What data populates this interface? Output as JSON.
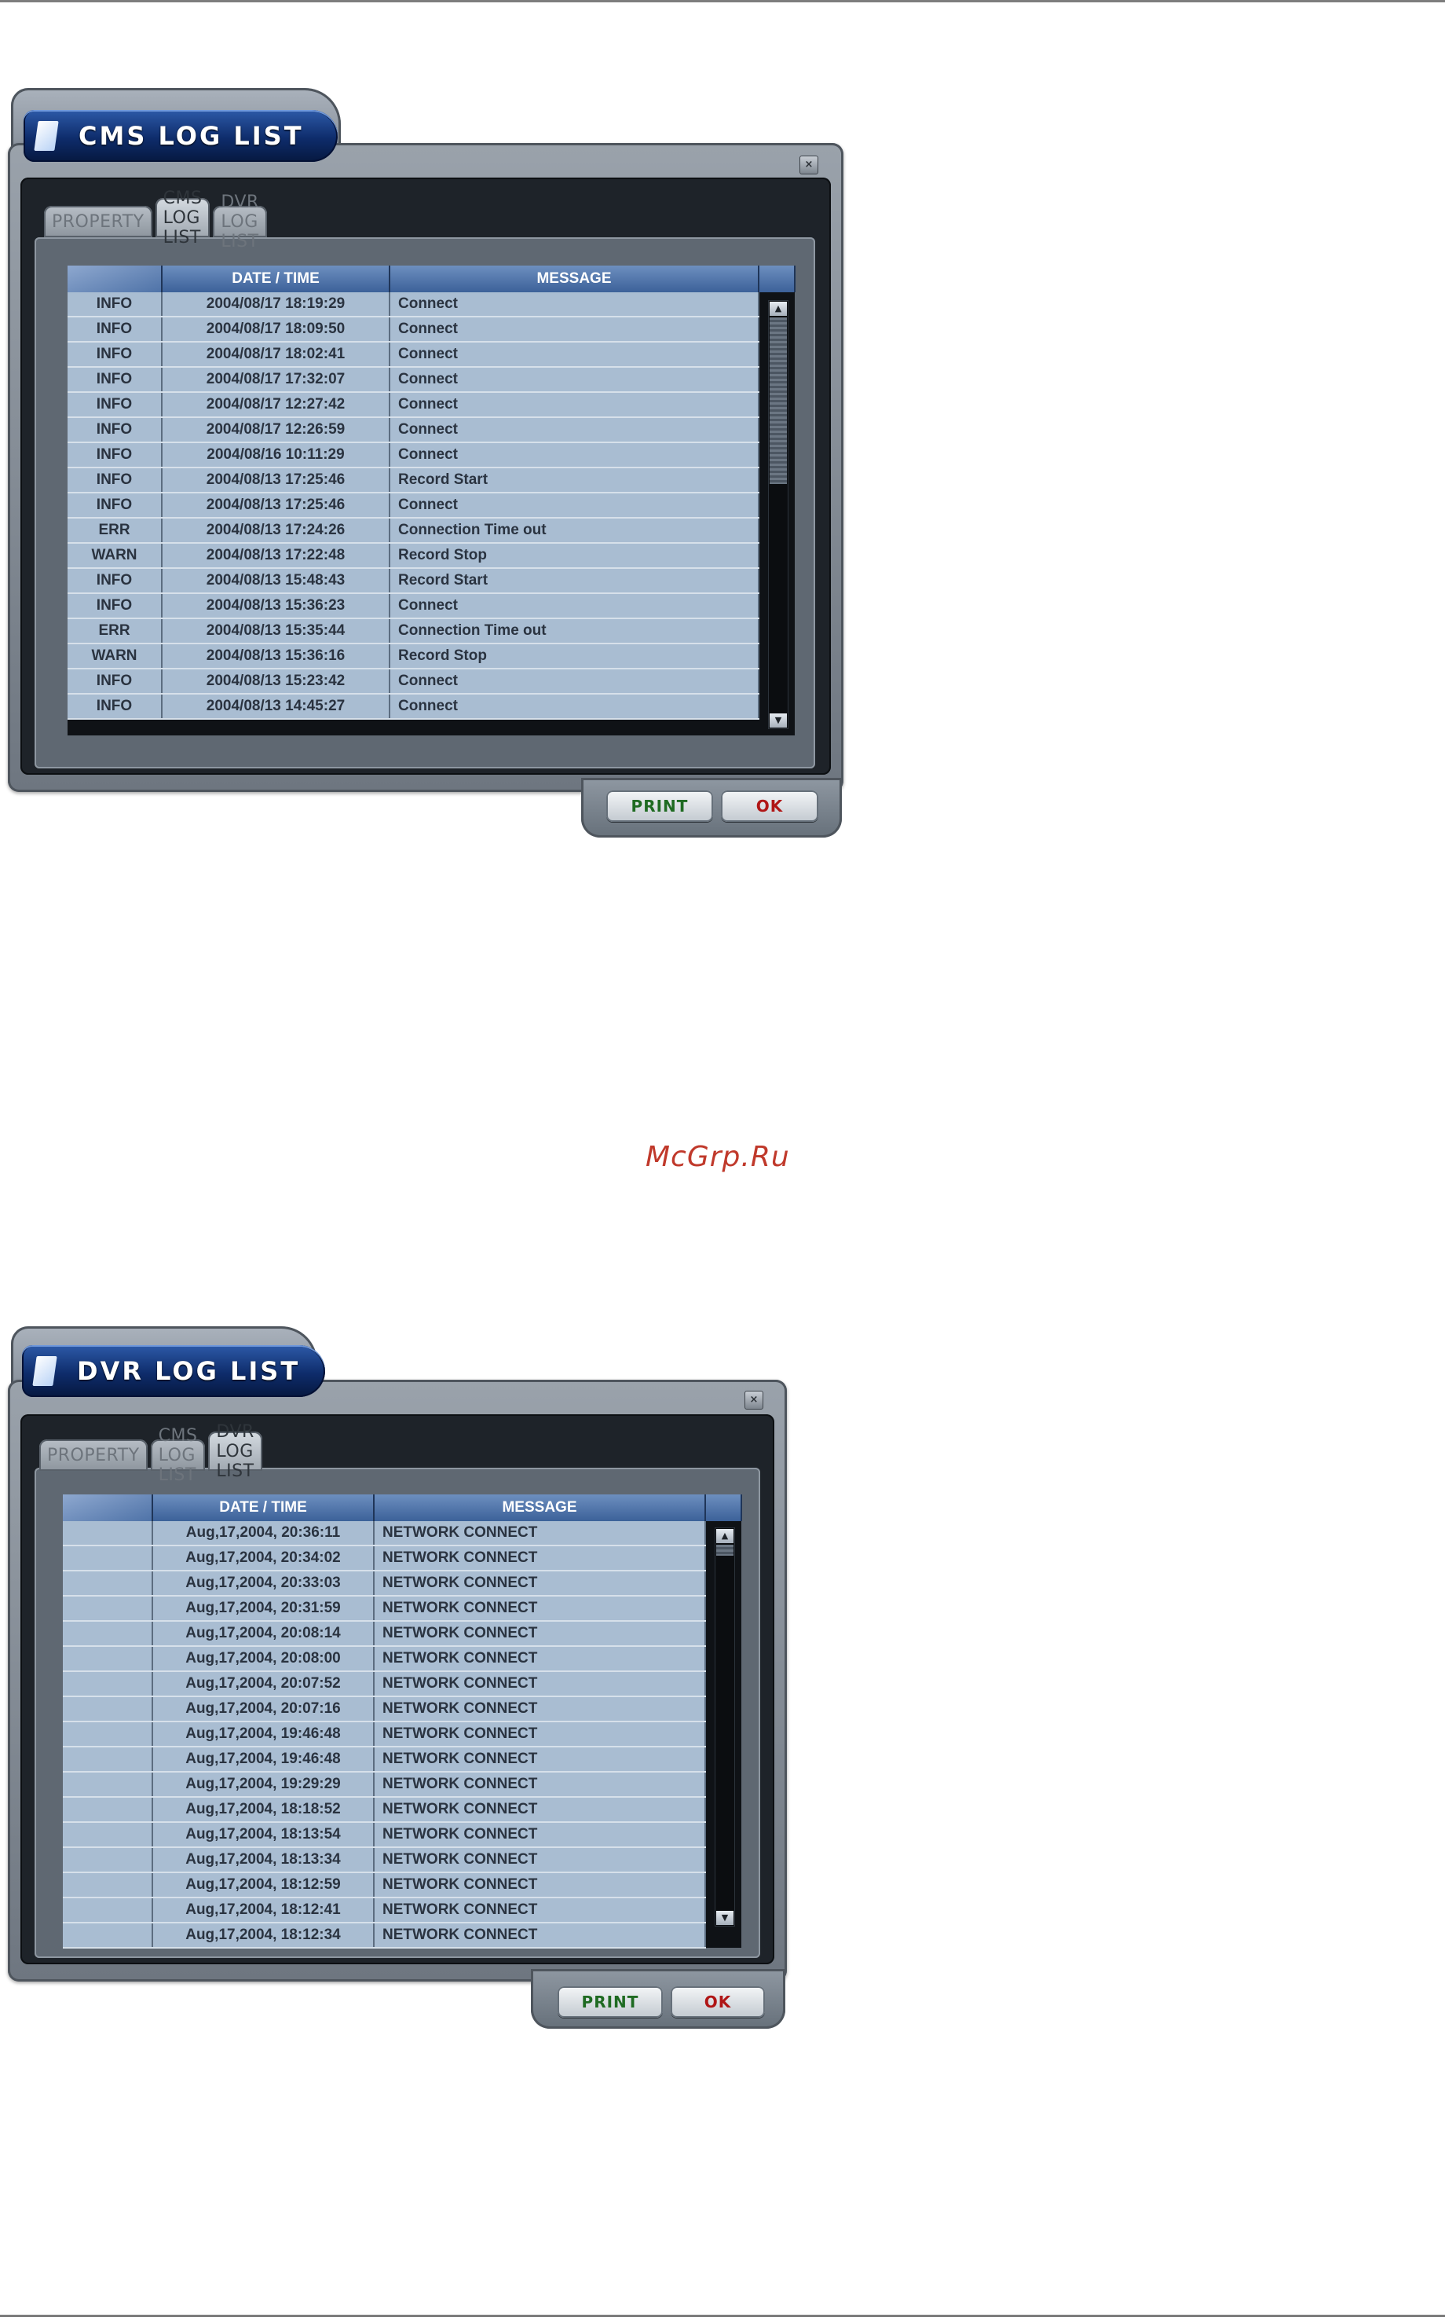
{
  "watermark": "McGrp.Ru",
  "windows": [
    {
      "title": "CMS LOG LIST",
      "close_glyph": "×",
      "tabs": [
        "PROPERTY",
        "CMS LOG LIST",
        "DVR LOG LIST"
      ],
      "active_tab": 1,
      "headers": [
        "",
        "DATE / TIME",
        "MESSAGE"
      ],
      "rows": [
        [
          "INFO",
          "2004/08/17 18:19:29",
          "Connect"
        ],
        [
          "INFO",
          "2004/08/17 18:09:50",
          "Connect"
        ],
        [
          "INFO",
          "2004/08/17 18:02:41",
          "Connect"
        ],
        [
          "INFO",
          "2004/08/17 17:32:07",
          "Connect"
        ],
        [
          "INFO",
          "2004/08/17 12:27:42",
          "Connect"
        ],
        [
          "INFO",
          "2004/08/17 12:26:59",
          "Connect"
        ],
        [
          "INFO",
          "2004/08/16 10:11:29",
          "Connect"
        ],
        [
          "INFO",
          "2004/08/13 17:25:46",
          "Record Start"
        ],
        [
          "INFO",
          "2004/08/13 17:25:46",
          "Connect"
        ],
        [
          "ERR",
          "2004/08/13 17:24:26",
          "Connection Time out"
        ],
        [
          "WARN",
          "2004/08/13 17:22:48",
          "Record Stop"
        ],
        [
          "INFO",
          "2004/08/13 15:48:43",
          "Record Start"
        ],
        [
          "INFO",
          "2004/08/13 15:36:23",
          "Connect"
        ],
        [
          "ERR",
          "2004/08/13 15:35:44",
          "Connection Time out"
        ],
        [
          "WARN",
          "2004/08/13 15:36:16",
          "Record Stop"
        ],
        [
          "INFO",
          "2004/08/13 15:23:42",
          "Connect"
        ],
        [
          "INFO",
          "2004/08/13 14:45:27",
          "Connect"
        ]
      ],
      "buttons": {
        "print": "PRINT",
        "ok": "OK"
      },
      "scroll_up": "▲",
      "scroll_down": "▼"
    },
    {
      "title": "DVR LOG LIST",
      "close_glyph": "×",
      "tabs": [
        "PROPERTY",
        "CMS LOG LIST",
        "DVR LOG LIST"
      ],
      "active_tab": 2,
      "headers": [
        "",
        "DATE / TIME",
        "MESSAGE"
      ],
      "rows": [
        [
          "",
          "Aug,17,2004, 20:36:11",
          "NETWORK CONNECT"
        ],
        [
          "",
          "Aug,17,2004, 20:34:02",
          "NETWORK CONNECT"
        ],
        [
          "",
          "Aug,17,2004, 20:33:03",
          "NETWORK CONNECT"
        ],
        [
          "",
          "Aug,17,2004, 20:31:59",
          "NETWORK CONNECT"
        ],
        [
          "",
          "Aug,17,2004, 20:08:14",
          "NETWORK CONNECT"
        ],
        [
          "",
          "Aug,17,2004, 20:08:00",
          "NETWORK CONNECT"
        ],
        [
          "",
          "Aug,17,2004, 20:07:52",
          "NETWORK CONNECT"
        ],
        [
          "",
          "Aug,17,2004, 20:07:16",
          "NETWORK CONNECT"
        ],
        [
          "",
          "Aug,17,2004, 19:46:48",
          "NETWORK CONNECT"
        ],
        [
          "",
          "Aug,17,2004, 19:46:48",
          "NETWORK CONNECT"
        ],
        [
          "",
          "Aug,17,2004, 19:29:29",
          "NETWORK CONNECT"
        ],
        [
          "",
          "Aug,17,2004, 18:18:52",
          "NETWORK CONNECT"
        ],
        [
          "",
          "Aug,17,2004, 18:13:54",
          "NETWORK CONNECT"
        ],
        [
          "",
          "Aug,17,2004, 18:13:34",
          "NETWORK CONNECT"
        ],
        [
          "",
          "Aug,17,2004, 18:12:59",
          "NETWORK CONNECT"
        ],
        [
          "",
          "Aug,17,2004, 18:12:41",
          "NETWORK CONNECT"
        ],
        [
          "",
          "Aug,17,2004, 18:12:34",
          "NETWORK CONNECT"
        ]
      ],
      "buttons": {
        "print": "PRINT",
        "ok": "OK"
      },
      "scroll_up": "▲",
      "scroll_down": "▼"
    }
  ]
}
